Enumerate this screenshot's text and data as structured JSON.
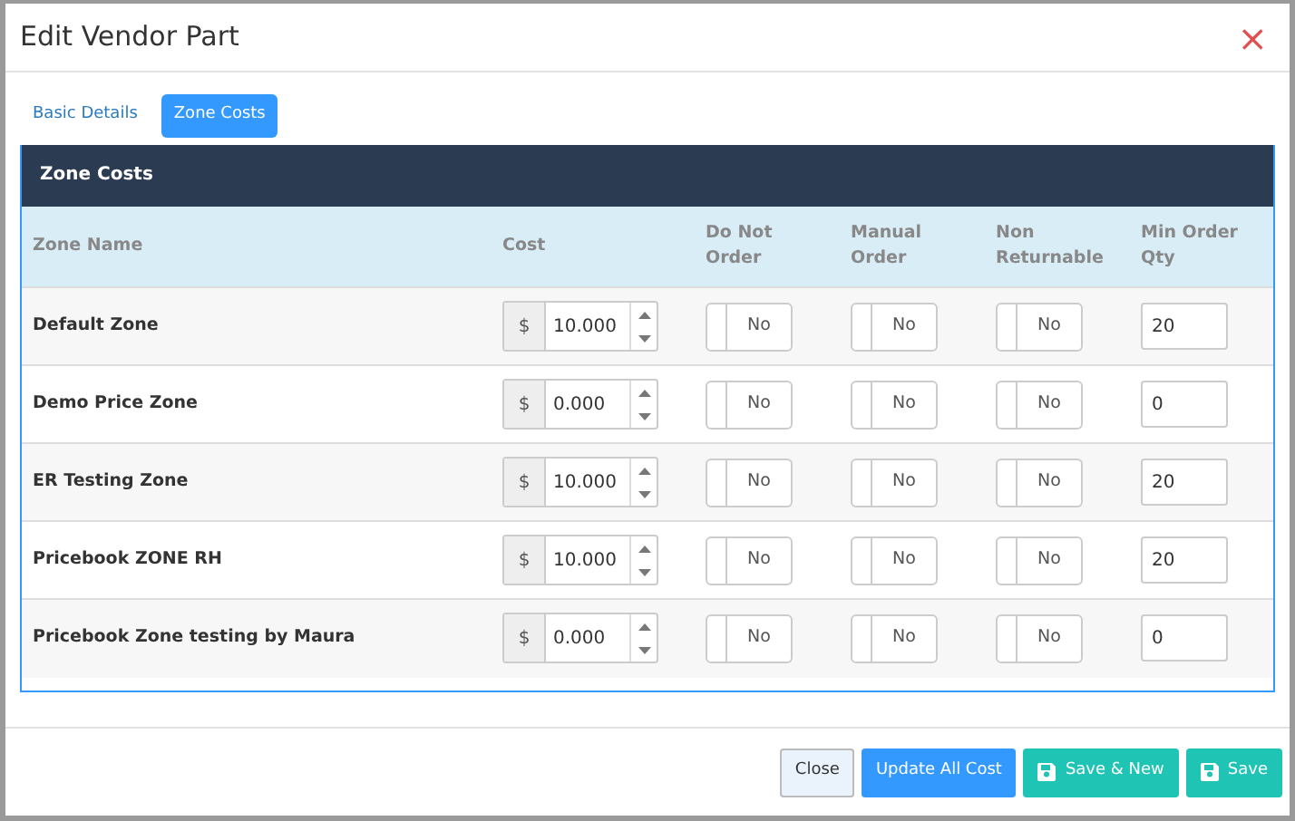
{
  "dialog": {
    "title": "Edit Vendor Part",
    "close": "×"
  },
  "tabs": [
    {
      "label": "Basic Details",
      "selected": false
    },
    {
      "label": "Zone Costs",
      "selected": true
    }
  ],
  "panel": {
    "title": "Zone Costs"
  },
  "table": {
    "columns": [
      "Zone Name",
      "Cost",
      "Do Not Order",
      "Manual Order",
      "Non Returnable",
      "Min Order Qty"
    ],
    "rows": [
      {
        "zone": "Default Zone",
        "currency": "$",
        "cost": "10.000",
        "do_not_order": {
          "label": "No",
          "on": false
        },
        "manual_order": {
          "label": "No",
          "on": false
        },
        "non_returnable": {
          "label": "No",
          "on": false
        },
        "min_qty": "20"
      },
      {
        "zone": "Demo Price Zone",
        "currency": "$",
        "cost": "0.000",
        "do_not_order": {
          "label": "No",
          "on": false
        },
        "manual_order": {
          "label": "No",
          "on": false
        },
        "non_returnable": {
          "label": "No",
          "on": false
        },
        "min_qty": "0"
      },
      {
        "zone": "ER Testing Zone",
        "currency": "$",
        "cost": "10.000",
        "do_not_order": {
          "label": "No",
          "on": false
        },
        "manual_order": {
          "label": "No",
          "on": false
        },
        "non_returnable": {
          "label": "No",
          "on": false
        },
        "min_qty": "20"
      },
      {
        "zone": "Pricebook ZONE RH",
        "currency": "$",
        "cost": "10.000",
        "do_not_order": {
          "label": "No",
          "on": false
        },
        "manual_order": {
          "label": "No",
          "on": false
        },
        "non_returnable": {
          "label": "No",
          "on": false
        },
        "min_qty": "20"
      },
      {
        "zone": "Pricebook Zone testing by Maura",
        "currency": "$",
        "cost": "0.000",
        "do_not_order": {
          "label": "No",
          "on": false
        },
        "manual_order": {
          "label": "No",
          "on": false
        },
        "non_returnable": {
          "label": "No",
          "on": false
        },
        "min_qty": "0"
      }
    ]
  },
  "footer": [
    {
      "label": "Close",
      "kind": "close"
    },
    {
      "label": "Update All Cost",
      "kind": "primary"
    },
    {
      "label": "Save & New",
      "kind": "save"
    },
    {
      "label": "Save",
      "kind": "save"
    }
  ]
}
